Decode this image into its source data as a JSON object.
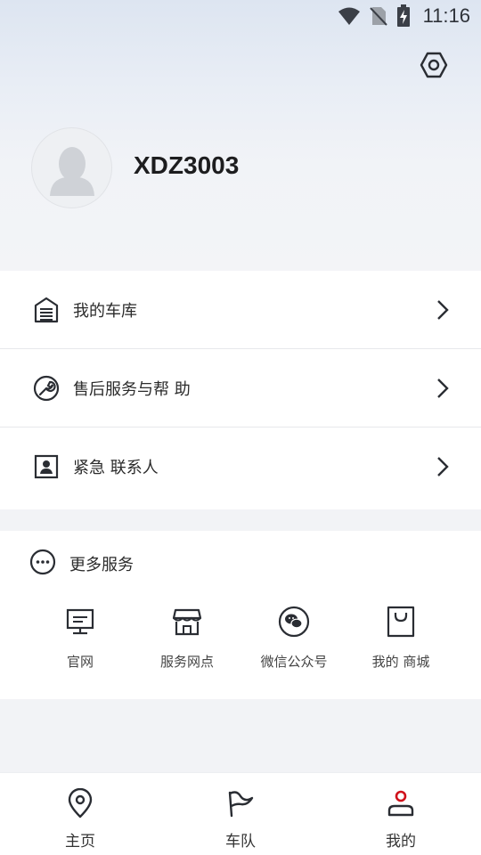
{
  "status_bar": {
    "time": "11:16"
  },
  "profile": {
    "username": "XDZ3003"
  },
  "menu": {
    "items": [
      {
        "label": "我的车库"
      },
      {
        "label": "售后服务与帮 助"
      },
      {
        "label": "紧急 联系人"
      }
    ]
  },
  "more_services": {
    "title": "更多服务",
    "items": [
      {
        "label": "官网"
      },
      {
        "label": "服务网点"
      },
      {
        "label": "微信公众号"
      },
      {
        "label": "我的 商城"
      }
    ]
  },
  "tabbar": {
    "tabs": [
      {
        "label": "主页"
      },
      {
        "label": "车队"
      },
      {
        "label": "我的"
      }
    ],
    "active_color": "#d0111b"
  }
}
